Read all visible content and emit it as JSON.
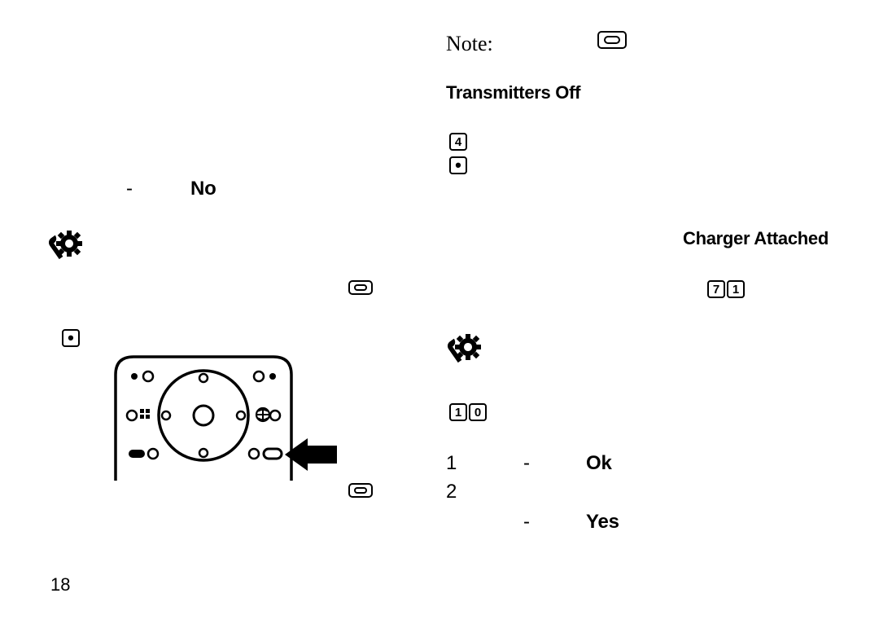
{
  "note_label": "Note:",
  "headings": {
    "transmitters_off": "Transmitters Off",
    "charger_attached": "Charger Attached"
  },
  "labels": {
    "no": "No",
    "ok": "Ok",
    "yes": "Yes"
  },
  "list": {
    "one": "1",
    "two": "2"
  },
  "keycaps": {
    "four": "4",
    "dot": "•",
    "seven": "7",
    "one": "1",
    "zero": "0"
  },
  "page_number": "18",
  "icons": {
    "pill": "menu-pill-icon",
    "gear": "settings-gear-wrench-icon",
    "keypad": "phone-keypad-diagram"
  }
}
